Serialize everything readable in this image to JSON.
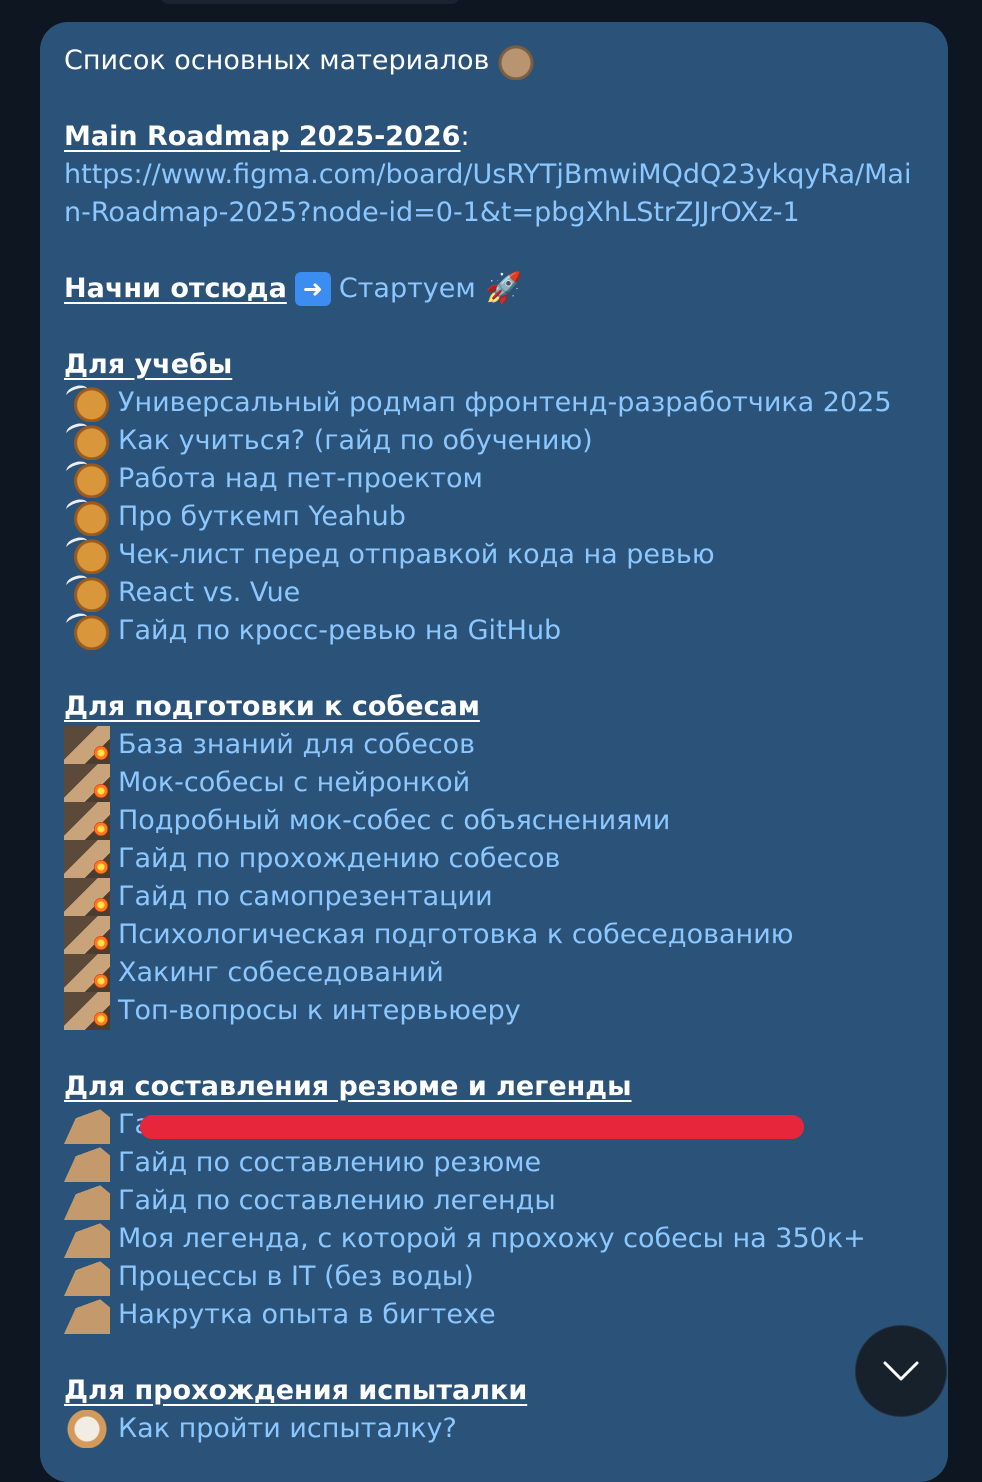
{
  "message": {
    "title": "Список основных материалов",
    "roadmap": {
      "label": "Main Roadmap 2025-2026",
      "colon": ":",
      "url": "https://www.figma.com/board/UsRYTjBmwiMQdQ23ykqyRa/Main-Roadmap-2025?node-id=0-1&t=pbgXhLStrZJJrOXz-1"
    },
    "start": {
      "label": "Начни отсюда",
      "link": "Стартуем"
    },
    "study": {
      "heading": "Для учебы",
      "icon": "dog-icon",
      "items": [
        "Универсальный родмап фронтенд-разработчика 2025",
        "Как учиться? (гайд по обучению)",
        "Работа над пет-проектом",
        "Про буткемп Yeahub",
        "Чек-лист перед отправкой кода на ревью",
        "React vs. Vue",
        "Гайд по кросс-ревью на GitHub"
      ]
    },
    "interviews": {
      "heading": "Для подготовки к собесам",
      "icon": "doge-bomb-icon",
      "items": [
        "База знаний для собесов",
        "Мок-собесы с нейронкой",
        "Подробный мок-собес с объяснениями",
        "Гайд по прохождению собесов",
        "Гайд по самопрезентации",
        "Психологическая подготовка к собеседованию",
        "Хакинг собеседований",
        "Топ-вопросы к интервьюеру"
      ]
    },
    "resume": {
      "heading": "Для составления резюме и легенды",
      "icon": "dog-profile-icon",
      "items": [
        "Га",
        "Гайд по составлению резюме",
        "Гайд по составлению легенды",
        "Моя легенда, с которой я прохожу собесы на 350к+",
        "Процессы в IT (без воды)",
        "Накрутка опыта в бигтехе"
      ]
    },
    "probation": {
      "heading": "Для прохождения испыталки",
      "icon": "shiba-icon",
      "items": [
        "Как пройти испыталку?"
      ]
    }
  },
  "colors": {
    "background": "#0e1621",
    "bubble": "#2b5278",
    "link": "#8cc8ff",
    "redaction": "#e8263b"
  },
  "scroll_button": {
    "icon": "chevron-down-icon"
  }
}
